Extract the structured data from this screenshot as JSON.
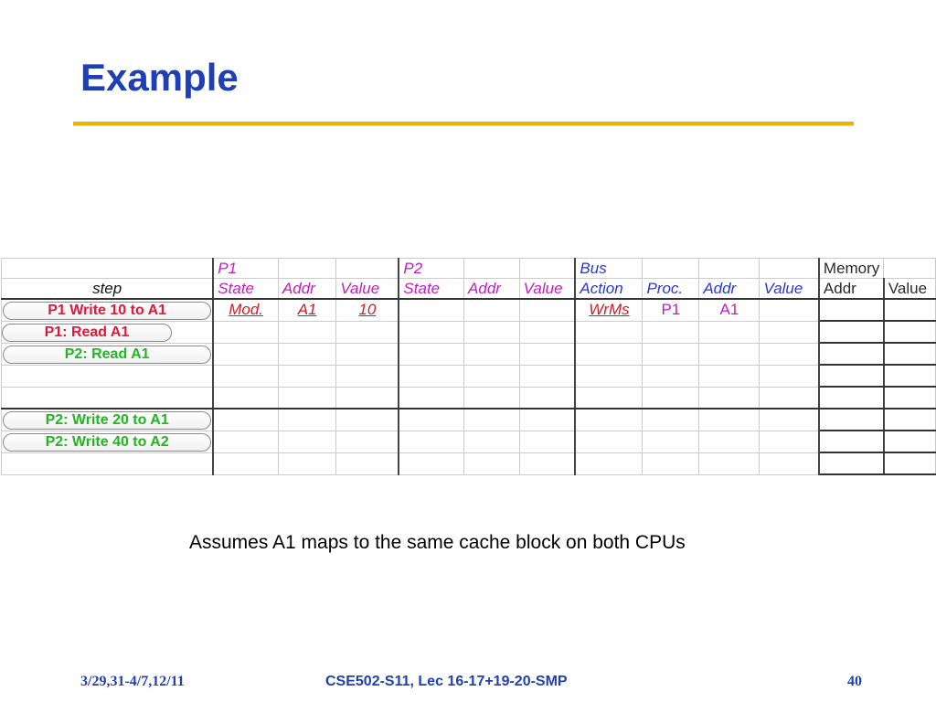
{
  "slide": {
    "title": "Example",
    "note": "Assumes A1 maps to the same cache block on both CPUs"
  },
  "table": {
    "groups": {
      "p1": "P1",
      "p2": "P2",
      "bus": "Bus",
      "memory": "Memory"
    },
    "columns": {
      "step": "step",
      "p1_state": "State",
      "p1_addr": "Addr",
      "p1_value": "Value",
      "p2_state": "State",
      "p2_addr": "Addr",
      "p2_value": "Value",
      "bus_action": "Action",
      "bus_proc": "Proc.",
      "bus_addr": "Addr",
      "bus_value": "Value",
      "mem_addr": "Addr",
      "mem_value": "Value"
    },
    "steps": [
      "P1 Write 10 to A1",
      "P1: Read A1",
      "P2: Read A1",
      "",
      "",
      "P2: Write 20 to A1",
      "P2: Write 40 to A2",
      ""
    ],
    "row1": {
      "p1_state": "Mod.",
      "p1_addr": "A1",
      "p1_value": "10",
      "bus_action": "WrMs",
      "bus_proc": "P1",
      "bus_addr": "A1"
    }
  },
  "colors": {
    "title": "#1f3fb5",
    "rule": "#e8b600",
    "p_group": "#c21cbf",
    "bus_group": "#2a38d6",
    "changed_value": "#cf1d28",
    "step_red": "#e0183a",
    "step_green": "#23b523"
  },
  "footer": {
    "date": "3/29,31-4/7,12/11",
    "course": "CSE502-S11, Lec 16-17+19-20-SMP",
    "page": "40"
  }
}
